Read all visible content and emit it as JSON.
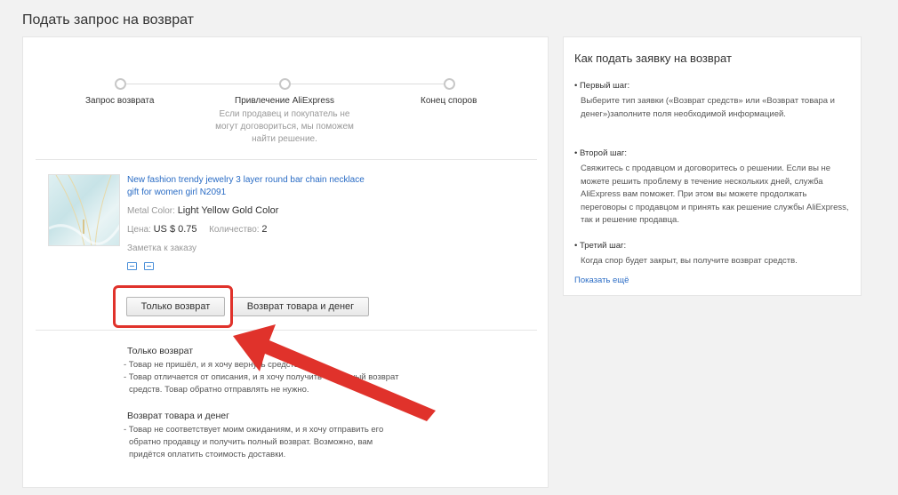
{
  "page": {
    "title": "Подать запрос на возврат"
  },
  "steps": [
    {
      "label": "Запрос возврата",
      "desc": ""
    },
    {
      "label": "Привлечение AliExpress",
      "desc": "Если продавец и покупатель не могут договориться, мы поможем найти решение."
    },
    {
      "label": "Конец споров",
      "desc": ""
    }
  ],
  "product": {
    "title": "New fashion trendy jewelry 3 layer round bar chain necklace gift for women girl N2091",
    "color_label": "Metal Color:",
    "color_value": "Light Yellow Gold Color",
    "price_label": "Цена:",
    "price_value": "US $ 0.75",
    "qty_label": "Количество:",
    "qty_value": "2",
    "note_label": "Заметка к заказу"
  },
  "buttons": {
    "refund_only": "Только возврат",
    "return_and_refund": "Возврат товара и денег"
  },
  "info": {
    "refund_only_heading": "Только возврат",
    "refund_only_lines": [
      "- Товар не пришёл, и я хочу вернуть средства, или",
      "- Товар отличается от описания, и я хочу получить частичный возврат",
      "  средств. Товар обратно отправлять не нужно."
    ],
    "return_heading": "Возврат товара и денег",
    "return_lines": [
      "- Товар не соответствует моим ожиданиям, и я хочу отправить его",
      "  обратно продавцу и получить полный возврат. Возможно, вам",
      "  придётся оплатить стоимость доставки."
    ]
  },
  "sidebar": {
    "title": "Как подать заявку на возврат",
    "steps": [
      {
        "label": "• Первый шаг:",
        "text": "Выберите тип заявки («Возврат средств» или «Возврат товара и денег»)заполните поля необходимой информацией."
      },
      {
        "label": "• Второй шаг:",
        "text": "Свяжитесь с продавцом и договоритесь о решении. Если вы не можете решить проблему в течение нескольких дней, служба AliExpress вам поможет. При этом вы можете продолжать переговоры с продавцом и принять как решение службы AliExpress, так и решение продавца."
      },
      {
        "label": "• Третий шаг:",
        "text": "Когда спор будет закрыт, вы получите возврат средств."
      }
    ],
    "more_link": "Показать ещё"
  },
  "colors": {
    "accent_link": "#2a6cc5",
    "highlight": "#e0322b"
  }
}
